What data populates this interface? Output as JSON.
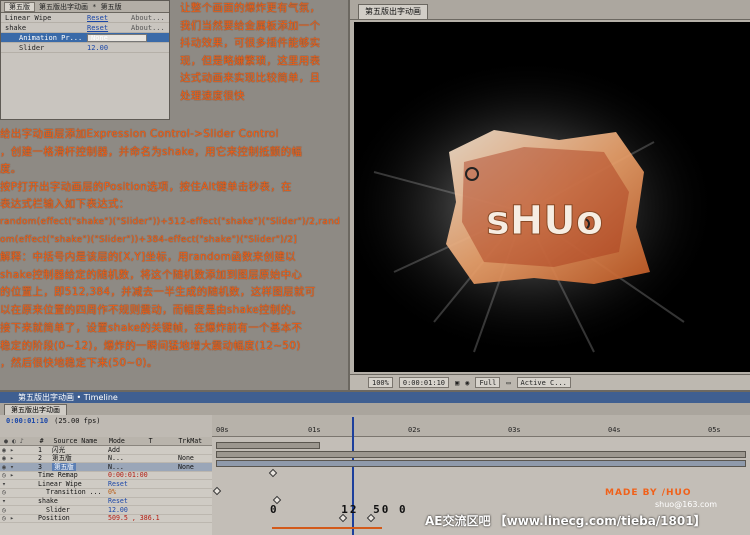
{
  "effect_controls": {
    "tab1": "第五版",
    "tab2": "第五版出字动画 * 第五版",
    "rows": [
      {
        "name": "Linear Wipe",
        "reset": "Reset",
        "about": "About..."
      },
      {
        "name": "shake",
        "reset": "Reset",
        "about": "About..."
      },
      {
        "name": "Animation Pr...",
        "dropdown": "None"
      },
      {
        "name": "Slider",
        "value": "12.00"
      }
    ]
  },
  "tutorial": {
    "top_lines": [
      "让整个画面的爆炸更有气氛，",
      "我们当然要给金属板添加一个",
      "抖动效果，可很多插件能够实",
      "现，但是略嫌繁琐，这里用表",
      "达式动画来实现比较简单，且",
      "处理速度很快"
    ],
    "mid_lines": [
      "给出字动画层添加Expression Control->Slider Control",
      "，创建一格滑杆控制器，并命名为shake，用它来控制抵颤的幅",
      "度。",
      "按P打开出字动画层的Position选项，按住Alt键单击秒表，在",
      "表达式栏输入如下表达式：",
      "random(effect(\"shake\")(\"Slider\"))+512-effect(\"shake\")(\"Slider\")/2,rand",
      "om(effect(\"shake\")(\"Slider\"))+384-effect(\"shake\")(\"Slider\")/2]",
      "解释：中括号内是该层的[X,Y]坐标，用random函数来创建以",
      "shake控制器给定的随机数，将这个随机数添加到图层原始中心",
      "的位置上，即512,384，并减去一半生成的随机数，这样图层就可",
      "以在原来位置的四周作不规则震动，而幅度是由shake控制的。"
    ],
    "bottom_lines": [
      "接下来就简单了，设置shake的关键帧，在爆炸前有一个基本不",
      "稳定的阶段(0~12)，爆炸的一瞬间猛地增大震动幅度(12~50)",
      "，然后很快地稳定下来(50~0)。"
    ]
  },
  "composition": {
    "tab": "第五版出字动画",
    "canvas_text": "sHUo",
    "footer": {
      "zoom": "100%",
      "timecode": "0:00:01:10",
      "resolution": "Full",
      "camera": "Active C..."
    }
  },
  "timeline": {
    "title": "第五版出字动画 • Timeline",
    "tab": "第五版出字动画",
    "timecode": "0:00:01:10",
    "fps": "(25.00 fps)",
    "header": {
      "num": "#",
      "source": "Source Name",
      "mode": "Mode",
      "t": "T",
      "trkmat": "TrkMat"
    },
    "layers": [
      {
        "index": "1",
        "name": "闪光",
        "mode": "Add",
        "trkmat": ""
      },
      {
        "index": "2",
        "name": "第五版",
        "mode": "N...",
        "trkmat": "None"
      },
      {
        "index": "3",
        "name": "第五版",
        "mode": "N...",
        "trkmat": "None"
      }
    ],
    "props": [
      {
        "name": "Time Remap",
        "value": "0:00:01:00"
      },
      {
        "name": "Linear Wipe",
        "value": "Reset"
      },
      {
        "name": "Transition ...",
        "value": "0%"
      },
      {
        "name": "shake",
        "value": "Reset"
      },
      {
        "name": "Slider",
        "value": "12.00"
      },
      {
        "name": "Position",
        "value": "509.5 , 386.1"
      }
    ],
    "ruler_labels": [
      "00s",
      "01s",
      "02s",
      "03s",
      "04s",
      "05s"
    ],
    "slider_values": [
      "0",
      "12",
      "50",
      "0"
    ]
  },
  "watermark": "MADE BY /HUO",
  "email": "shuo@163.com",
  "footer_text": "AE交流区吧 【www.linecg.com/tieba/1801】",
  "colors": {
    "tutorial_text": "#f0611a",
    "accent_blue": "#3f5f91",
    "link_blue": "#1b47a8"
  }
}
